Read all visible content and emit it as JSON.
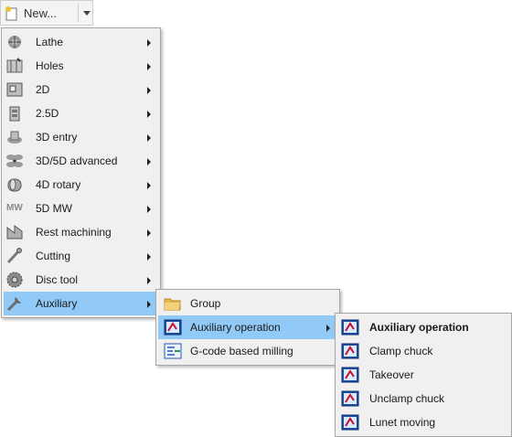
{
  "toolbar": {
    "new_label": "New..."
  },
  "main_menu": [
    {
      "label": "Lathe",
      "icon": "lathe-icon"
    },
    {
      "label": "Holes",
      "icon": "holes-icon"
    },
    {
      "label": "2D",
      "icon": "2d-icon"
    },
    {
      "label": "2.5D",
      "icon": "2-5d-icon"
    },
    {
      "label": "3D entry",
      "icon": "3d-entry-icon"
    },
    {
      "label": "3D/5D advanced",
      "icon": "fan-icon"
    },
    {
      "label": "4D rotary",
      "icon": "rotary-icon"
    },
    {
      "label": "5D MW",
      "icon": "mw-icon",
      "icon_text": "MW"
    },
    {
      "label": "Rest machining",
      "icon": "rest-machining-icon"
    },
    {
      "label": "Cutting",
      "icon": "cutting-icon"
    },
    {
      "label": "Disc tool",
      "icon": "disc-tool-icon"
    },
    {
      "label": "Auxiliary",
      "icon": "wrench-icon",
      "selected": true
    }
  ],
  "auxiliary_menu": [
    {
      "label": "Group",
      "icon": "folder-icon"
    },
    {
      "label": "Auxiliary operation",
      "icon": "operation-icon",
      "selected": true
    },
    {
      "label": "G-code based milling",
      "icon": "gcode-icon"
    }
  ],
  "operation_menu": [
    {
      "label": "Auxiliary operation",
      "bold": true
    },
    {
      "label": "Clamp chuck"
    },
    {
      "label": "Takeover"
    },
    {
      "label": "Unclamp chuck"
    },
    {
      "label": "Lunet moving"
    }
  ],
  "colors": {
    "highlight": "#91c9f7",
    "menu_bg": "#f0f0f0",
    "border": "#a6a6a6"
  }
}
